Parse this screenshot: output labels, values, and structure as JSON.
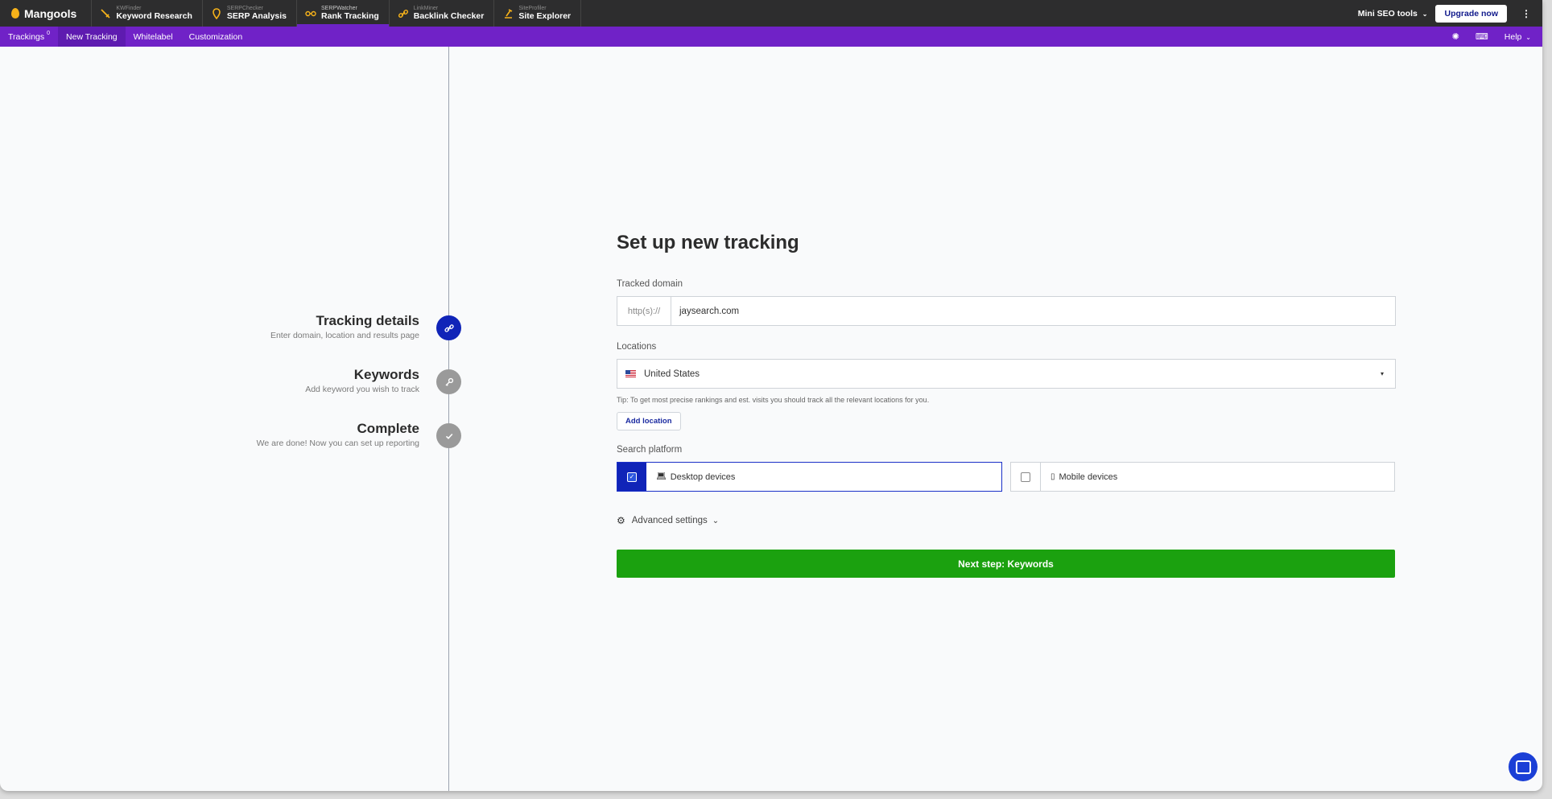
{
  "topbar": {
    "logo": "Mangools",
    "apps": [
      {
        "sub": "KWFinder",
        "main": "Keyword Research",
        "icon": "keyword-icon"
      },
      {
        "sub": "SERPChecker",
        "main": "SERP Analysis",
        "icon": "pin-icon"
      },
      {
        "sub": "SERPWatcher",
        "main": "Rank Tracking",
        "icon": "glasses-icon"
      },
      {
        "sub": "LinkMiner",
        "main": "Backlink Checker",
        "icon": "link-icon"
      },
      {
        "sub": "SiteProfiler",
        "main": "Site Explorer",
        "icon": "microscope-icon"
      }
    ],
    "mini_tools": "Mini SEO tools",
    "upgrade": "Upgrade now"
  },
  "subnav": {
    "trackings": "Trackings",
    "trackings_count": "0",
    "new_tracking": "New Tracking",
    "whitelabel": "Whitelabel",
    "customization": "Customization",
    "help": "Help"
  },
  "steps": [
    {
      "title": "Tracking details",
      "desc": "Enter domain, location and results page",
      "icon": "link-icon",
      "color": "#1024b8"
    },
    {
      "title": "Keywords",
      "desc": "Add keyword you wish to track",
      "icon": "key-icon",
      "color": "#9a9a9a"
    },
    {
      "title": "Complete",
      "desc": "We are done! Now you can set up reporting",
      "icon": "check-icon",
      "color": "#9a9a9a"
    }
  ],
  "form": {
    "title": "Set up new tracking",
    "domain_label": "Tracked domain",
    "domain_prefix": "http(s)://",
    "domain_value": "jaysearch.com",
    "locations_label": "Locations",
    "location_value": "United States",
    "tip": "Tip: To get most precise rankings and est. visits you should track all the relevant locations for you.",
    "add_location": "Add location",
    "platform_label": "Search platform",
    "desktop": "Desktop devices",
    "mobile": "Mobile devices",
    "desktop_checked": true,
    "mobile_checked": false,
    "advanced": "Advanced settings",
    "next": "Next step: Keywords"
  }
}
